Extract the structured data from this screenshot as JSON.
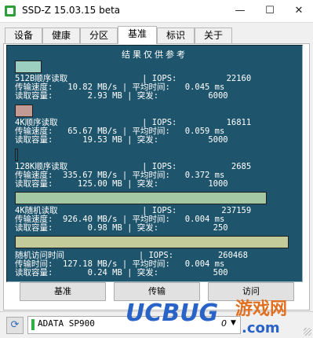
{
  "window": {
    "title": "SSD-Z 15.03.15 beta",
    "minimize_glyph": "—",
    "maximize_glyph": "☐",
    "close_glyph": "✕"
  },
  "tabs": [
    {
      "label": "设备",
      "active": false
    },
    {
      "label": "健康",
      "active": false
    },
    {
      "label": "分区",
      "active": false
    },
    {
      "label": "基准",
      "active": true
    },
    {
      "label": "标识",
      "active": false
    },
    {
      "label": "关于",
      "active": false
    }
  ],
  "results": {
    "title": "结果仅供参考",
    "tests": [
      {
        "bar_color": "#9ccfbf",
        "bar_level": 0.09,
        "line1": "512B顺序读取               | IOPS:          22160",
        "line2": "传输速度:   10.82 MB/s | 平均时间:   0.045 ms",
        "line3": "读取容量:       2.93 MB | 突发:          6000"
      },
      {
        "bar_color": "#c49b94",
        "bar_level": 0.06,
        "line1": "4K顺序读取                 | IOPS:          16811",
        "line2": "传输速度:   65.67 MB/s | 平均时间:   0.059 ms",
        "line3": "读取容量:      19.53 MB | 突发:          5000"
      },
      {
        "bar_color": "#1f556c",
        "bar_level": 0.005,
        "line1": "128K顺序读取               | IOPS:           2685",
        "line2": "传输速度:  335.67 MB/s | 平均时间:   0.372 ms",
        "line3": "读取容量:     125.00 MB | 突发:          1000"
      },
      {
        "bar_color": "#a4c8a4",
        "bar_level": 0.9,
        "line1": "4K随机读取                 | IOPS:         237159",
        "line2": "传输速度:  926.40 MB/s | 平均时间:   0.004 ms",
        "line3": "读取容量:       0.98 MB | 突发:           250"
      },
      {
        "bar_color": "#c3cb9a",
        "bar_level": 0.98,
        "line1": "随机访问时间               | IOPS:         260468",
        "line2": "传输时间:  127.18 MB/s | 平均时间:   0.004 ms",
        "line3": "读取容量:       0.24 MB | 突发:           500"
      }
    ]
  },
  "buttons": {
    "benchmark": "基准",
    "transfer": "传输",
    "access": "访问"
  },
  "drive": {
    "name": "ADATA SP900",
    "letter": "0"
  },
  "watermark": {
    "brand": "UCBUG",
    "game_text": "游戏网",
    "domain": ".com"
  }
}
